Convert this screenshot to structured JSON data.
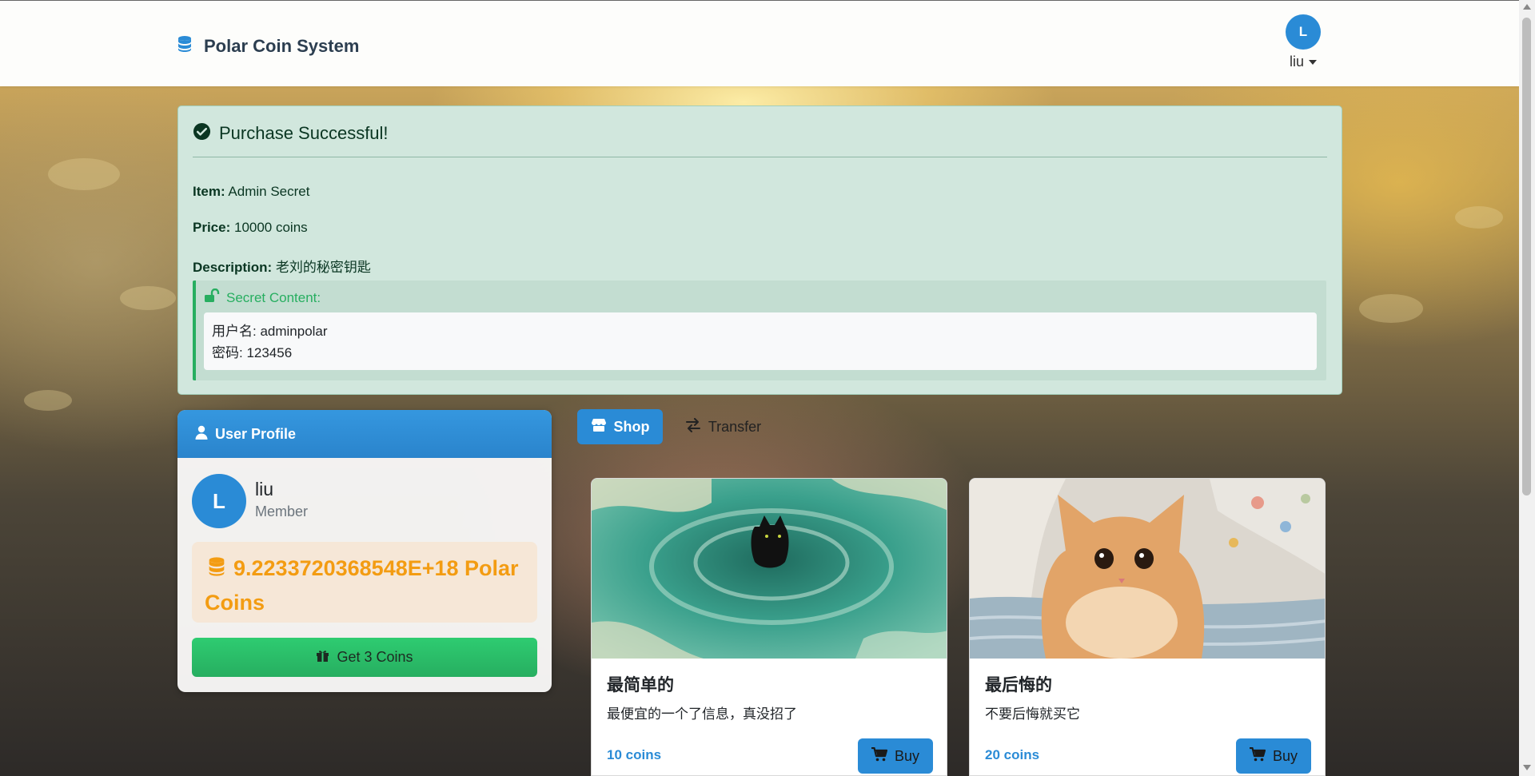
{
  "navbar": {
    "brand": "Polar Coin System",
    "user": {
      "avatar_letter": "L",
      "name": "liu"
    }
  },
  "alert": {
    "title": "Purchase Successful!",
    "item_label": "Item:",
    "item_value": "Admin Secret",
    "price_label": "Price:",
    "price_value": "10000 coins",
    "description_label": "Description:",
    "description_value": "老刘的秘密钥匙",
    "secret_label": "Secret Content:",
    "secret_line1": "用户名: adminpolar",
    "secret_line2": "密码: 123456"
  },
  "profile": {
    "header": "User Profile",
    "avatar_letter": "L",
    "name": "liu",
    "role": "Member",
    "coins": "9.2233720368548E+18 Polar Coins",
    "get_coins_button": "Get 3 Coins"
  },
  "tabs": [
    {
      "label": "Shop",
      "active": true
    },
    {
      "label": "Transfer",
      "active": false
    }
  ],
  "products": [
    {
      "title": "最简单的",
      "description": "最便宜的一个了信息，真没招了",
      "price": "10 coins",
      "buy_label": "Buy"
    },
    {
      "title": "最后悔的",
      "description": "不要后悔就买它",
      "price": "20 coins",
      "buy_label": "Buy"
    }
  ],
  "colors": {
    "primary": "#2a8bd6",
    "success": "#27ae60",
    "coins": "#f39c12",
    "alert_bg": "#d1e7dd"
  },
  "icons": {
    "brand": "coins-icon",
    "alert": "check-circle-icon",
    "secret": "unlock-icon",
    "profile": "user-icon",
    "coins": "coins-icon",
    "gift": "gift-icon",
    "shop": "store-icon",
    "transfer": "exchange-icon",
    "buy": "cart-icon"
  }
}
